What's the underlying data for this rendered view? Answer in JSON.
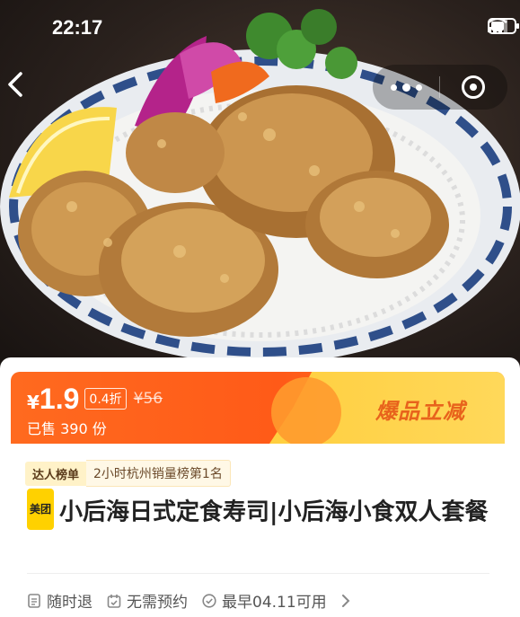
{
  "status_bar": {
    "time": "22:17"
  },
  "price": {
    "currency": "¥",
    "value": "1.9",
    "discount": "0.4折",
    "original": "¥56",
    "sold": "已售 390 份"
  },
  "promo": {
    "label": "爆品立减"
  },
  "rank": {
    "badge": "达人榜单",
    "text": "2小时杭州销量榜第1名"
  },
  "product": {
    "brand_badge": "美团",
    "title": "小后海日式定食寿司|小后海小食双人套餐"
  },
  "services": [
    {
      "label": "随时退",
      "icon": "document-icon"
    },
    {
      "label": "无需预约",
      "icon": "calendar-check-icon"
    },
    {
      "label": "最早04.11可用",
      "icon": "check-circle-icon"
    }
  ]
}
